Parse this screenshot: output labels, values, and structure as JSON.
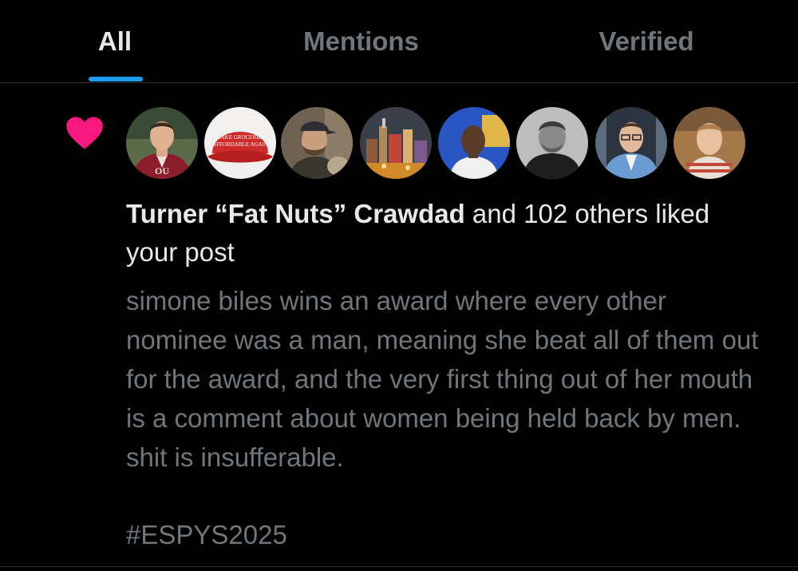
{
  "tabs": {
    "all": "All",
    "mentions": "Mentions",
    "verified": "Verified"
  },
  "notification": {
    "icon": "heart-icon",
    "icon_color": "#f91880",
    "liker_name": "Turner “Fat Nuts” Crawdad",
    "liked_suffix": " and 102 others liked your post",
    "post_text": "simone biles wins an award where every other nominee was a man, meaning she beat all of them out for the award, and the very first thing out of her mouth is a comment about women being held back by men. shit is insufferable.",
    "hashtag": "#ESPYS2025",
    "hat_text": [
      "MAKE GROCERIES",
      "AFFORDABLE AGAIN"
    ]
  },
  "colors": {
    "background": "#000000",
    "primary_text": "#e7e9ea",
    "secondary_text": "#71767b",
    "accent": "#1d9bf0",
    "like": "#f91880"
  }
}
